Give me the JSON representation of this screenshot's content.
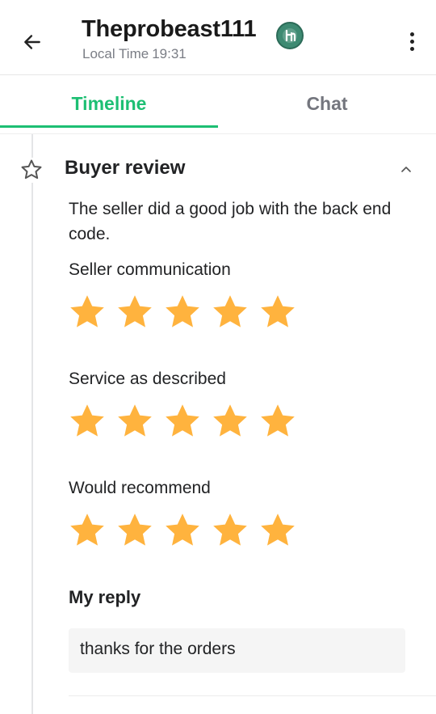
{
  "header": {
    "username": "Theprobeast111",
    "local_time_label": "Local Time",
    "local_time_value": "19:31",
    "back_icon": "arrow-left-icon",
    "more_icon": "more-vertical-icon"
  },
  "tabs": [
    {
      "label": "Timeline",
      "active": true
    },
    {
      "label": "Chat",
      "active": false
    }
  ],
  "colors": {
    "accent": "#1dbf73",
    "star": "#ffb33e",
    "muted_text": "#74767e"
  },
  "review": {
    "title": "Buyer review",
    "text": "The seller did a good job with the back end code.",
    "ratings": [
      {
        "label": "Seller communication",
        "stars": 5,
        "max": 5
      },
      {
        "label": "Service as described",
        "stars": 5,
        "max": 5
      },
      {
        "label": "Would recommend",
        "stars": 5,
        "max": 5
      }
    ]
  },
  "reply": {
    "title": "My reply",
    "text": "thanks for the orders"
  }
}
